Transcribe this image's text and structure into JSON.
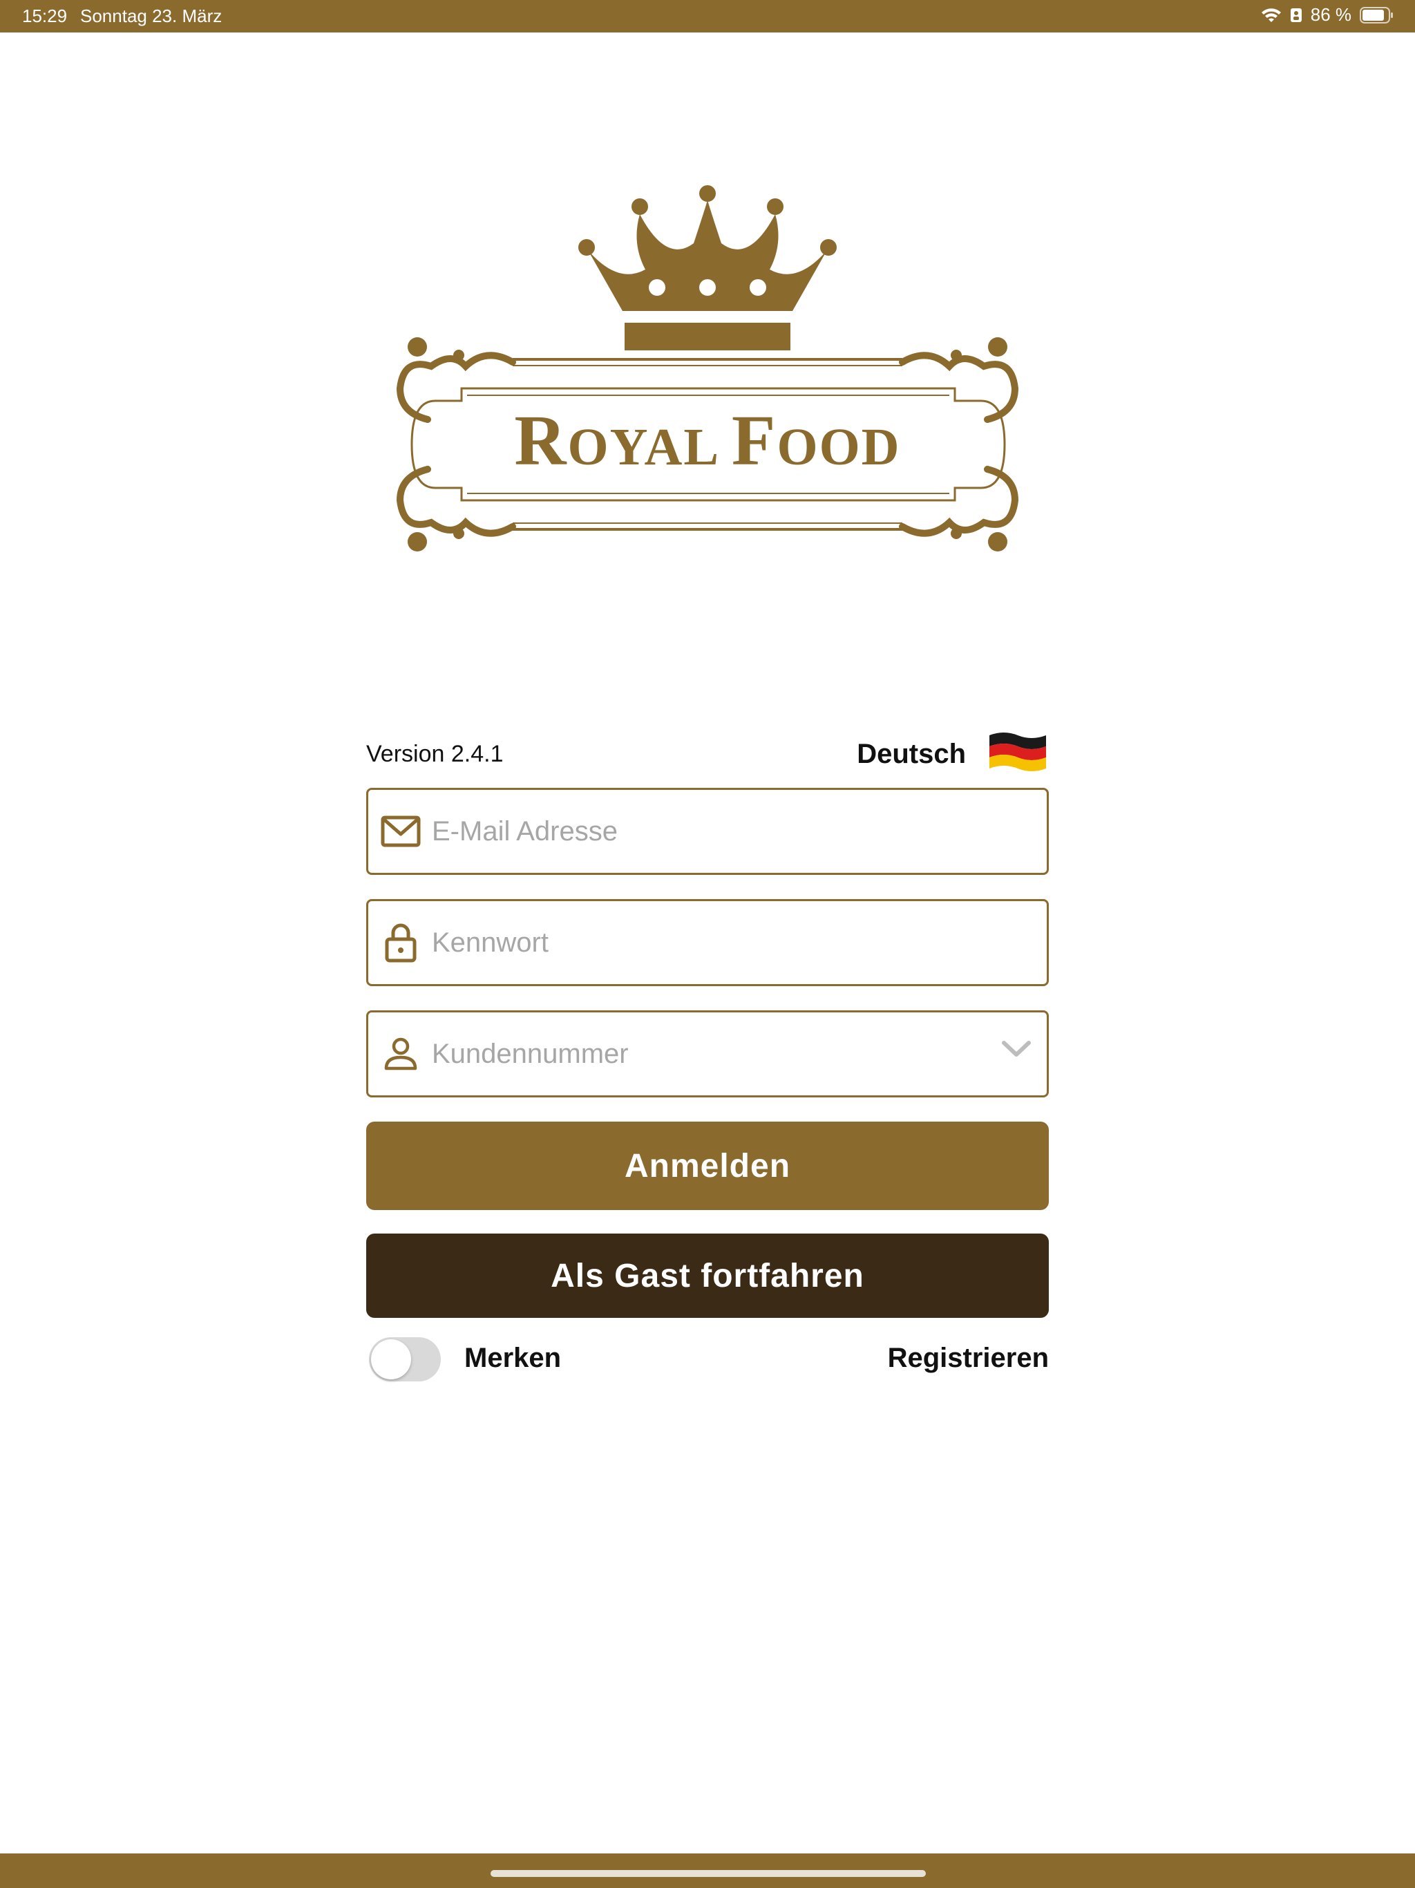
{
  "status_bar": {
    "time": "15:29",
    "date": "Sonntag 23. März",
    "battery_text": "86 %",
    "battery_level": 0.86
  },
  "logo": {
    "brand_text": "Royal Food",
    "icon": "crown-icon"
  },
  "form": {
    "version": "Version 2.4.1",
    "language_label": "Deutsch",
    "language_flag": "german-flag-icon",
    "email": {
      "placeholder": "E-Mail Adresse",
      "value": "",
      "icon": "envelope-icon"
    },
    "password": {
      "placeholder": "Kennwort",
      "value": "",
      "icon": "lock-icon"
    },
    "customer_number": {
      "placeholder": "Kundennummer",
      "value": "",
      "icon": "person-icon"
    },
    "login_label": "Anmelden",
    "guest_label": "Als Gast fortfahren",
    "remember_label": "Merken",
    "remember_on": false,
    "register_label": "Registrieren"
  },
  "colors": {
    "brand": "#8b6a2e",
    "dark": "#3b2a16",
    "placeholder": "#a6a6a6"
  }
}
